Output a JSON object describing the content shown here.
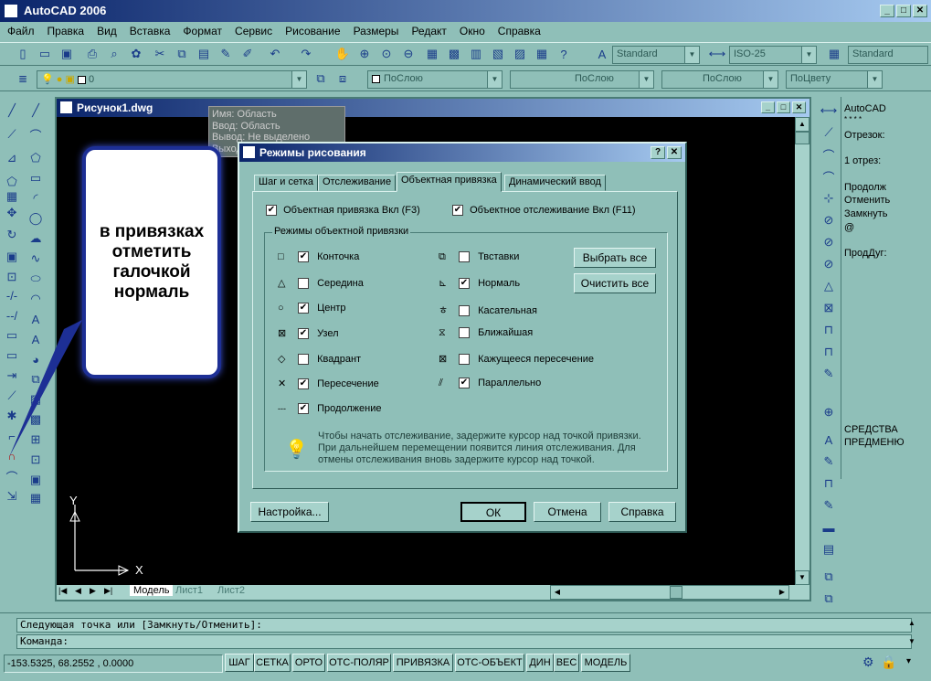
{
  "app_title": "AutoCAD 2006",
  "menu": [
    "Файл",
    "Правка",
    "Вид",
    "Вставка",
    "Формат",
    "Сервис",
    "Рисование",
    "Размеры",
    "Редакт",
    "Окно",
    "Справка"
  ],
  "toolbar": {
    "text_style": "Standard",
    "dim_style": "ISO-25",
    "table_style": "Standard",
    "layer": "0",
    "color": "ПоСлою",
    "linetype": "ПоСлою",
    "lineweight": "ПоСлою",
    "plotstyle": "ПоЦвету"
  },
  "drawing": {
    "title": "Рисунок1.dwg",
    "tabs": [
      "Модель",
      "Лист1",
      "Лист2"
    ],
    "ucs_x": "X",
    "ucs_y": "Y",
    "tooltip": [
      "Имя: Область",
      "Ввод: Область",
      "Вывод: Не выделено",
      "Выход: Не выделено"
    ]
  },
  "callout": "в привязках отметить галочкой нормаль",
  "dialog": {
    "title": "Режимы рисования",
    "help_btn": "?",
    "close_btn": "✕",
    "tabs": [
      "Шаг и сетка",
      "Отслеживание",
      "Объектная привязка",
      "Динамический ввод"
    ],
    "osnap_on": "Объектная привязка Вкл (F3)",
    "otrack_on": "Объектное отслеживание Вкл (F11)",
    "group_label": "Режимы объектной привязки",
    "left_modes": [
      {
        "symbol": "□",
        "label": "Конточка",
        "checked": true
      },
      {
        "symbol": "△",
        "label": "Середина",
        "checked": false
      },
      {
        "symbol": "○",
        "label": "Центр",
        "checked": true
      },
      {
        "symbol": "⊠",
        "label": "Узел",
        "checked": true
      },
      {
        "symbol": "◇",
        "label": "Квадрант",
        "checked": false
      },
      {
        "symbol": "✕",
        "label": "Пересечение",
        "checked": true
      },
      {
        "symbol": "---",
        "label": "Продолжение",
        "checked": true
      }
    ],
    "right_modes": [
      {
        "symbol": "⧉",
        "label": "Твставки",
        "checked": false
      },
      {
        "symbol": "⊾",
        "label": "Нормаль",
        "checked": true
      },
      {
        "symbol": "ㅎ",
        "label": "Касательная",
        "checked": false
      },
      {
        "symbol": "⧖",
        "label": "Ближайшая",
        "checked": false
      },
      {
        "symbol": "⊠",
        "label": "Кажущееся пересечение",
        "checked": false
      },
      {
        "symbol": "⫽",
        "label": "Параллельно",
        "checked": true
      }
    ],
    "select_all": "Выбрать все",
    "clear_all": "Очистить все",
    "hint": "Чтобы начать отслеживание, задержите курсор над точкой привязки. При дальнейшем перемещении появится линия отслеживания. Для отмены отслеживания вновь задержите курсор над точкой.",
    "options_btn": "Настройка...",
    "ok_btn": "ОК",
    "cancel_btn": "Отмена",
    "help_button": "Справка"
  },
  "right_panel": {
    "lines": [
      "AutoCAD",
      "* * * *",
      "Отрезок:",
      "",
      "1 отрез:",
      "",
      "Продолж",
      "Отменить",
      "Замкнуть",
      "@",
      "",
      "ПродДуг:"
    ],
    "bottom_lines": [
      "СРЕДСТВА",
      "ПРЕДМЕНЮ"
    ]
  },
  "command": {
    "line1": "Следующая точка или [Замкнуть/Отменить]:",
    "line2": "Команда:"
  },
  "status": {
    "coords": "-153.5325, 68.2552 , 0.0000",
    "buttons": [
      "ШАГ",
      "СЕТКА",
      "ОРТО",
      "ОТС-ПОЛЯР",
      "ПРИВЯЗКА",
      "ОТС-ОБЪЕКТ",
      "ДИН",
      "ВЕС",
      "МОДЕЛЬ"
    ]
  }
}
